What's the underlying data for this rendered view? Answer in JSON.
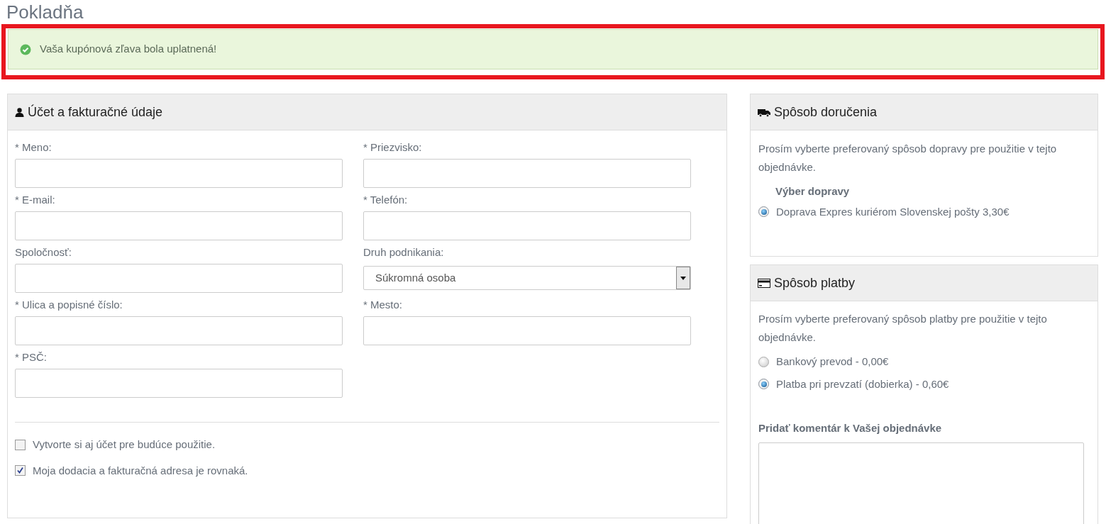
{
  "title": "Pokladňa",
  "alert": {
    "text": "Vaša kupónová zľava bola uplatnená!"
  },
  "billing": {
    "title": "Účet a fakturačné údaje",
    "fields": [
      {
        "label": "* Meno:",
        "kind": "text"
      },
      {
        "label": "* Priezvisko:",
        "kind": "text"
      },
      {
        "label": "* E-mail:",
        "kind": "text"
      },
      {
        "label": "* Telefón:",
        "kind": "text"
      },
      {
        "label": "Spoločnosť:",
        "kind": "text"
      },
      {
        "label": "Druh podnikania:",
        "kind": "select",
        "value": "Súkromná osoba"
      },
      {
        "label": "* Ulica a popisné číslo:",
        "kind": "text"
      },
      {
        "label": "* Mesto:",
        "kind": "text"
      },
      {
        "label": "* PSČ:",
        "kind": "text"
      }
    ],
    "checkboxes": [
      {
        "label": "Vytvorte si aj účet pre budúce použitie.",
        "checked": false
      },
      {
        "label": "Moja dodacia a fakturačná adresa je rovnaká.",
        "checked": true
      }
    ]
  },
  "shipping": {
    "title": "Spôsob doručenia",
    "intro": "Prosím vyberte preferovaný spôsob dopravy pre použitie v tejto objednávke.",
    "group_label": "Výber dopravy",
    "options": [
      {
        "label": "Doprava Expres kuriérom Slovenskej pošty",
        "price": "3,30€",
        "selected": true
      }
    ]
  },
  "payment": {
    "title": "Spôsob platby",
    "intro": "Prosím vyberte preferovaný spôsob platby pre použitie v tejto objednávke.",
    "options": [
      {
        "label": "Bankový prevod - 0,00€",
        "selected": false
      },
      {
        "label": "Platba pri prevzatí (dobierka) - 0,60€",
        "selected": true
      }
    ],
    "comment_label": "Pridať komentár k Vašej objednávke"
  }
}
